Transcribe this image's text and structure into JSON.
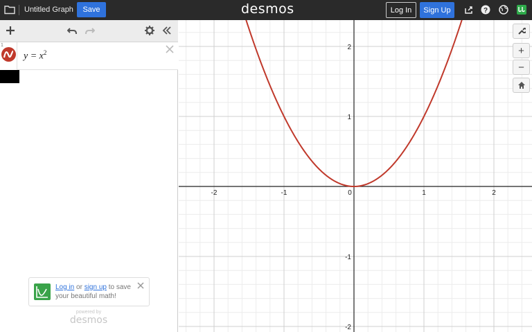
{
  "topbar": {
    "title": "Untitled Graph",
    "save_label": "Save",
    "brand": "desmos",
    "login_label": "Log In",
    "signup_label": "Sign Up",
    "icons": [
      "folder-icon",
      "share-icon",
      "help-icon",
      "language-icon",
      "account-icon"
    ]
  },
  "toolbar": {
    "icons": [
      "add-icon",
      "undo-icon",
      "redo-icon",
      "settings-icon",
      "collapse-icon"
    ]
  },
  "expressions": [
    {
      "number": "1",
      "latex_lhs": "y = x",
      "exponent": "2",
      "color": "#c0392b"
    }
  ],
  "promo": {
    "login_link": "Log in",
    "or_text": " or ",
    "signup_link": "sign up",
    "rest_text": " to save your beautiful math!"
  },
  "powered": {
    "line1": "powered by",
    "line2": "desmos"
  },
  "graph": {
    "x_ticks": [
      "-2",
      "-1",
      "0",
      "1",
      "2"
    ],
    "y_ticks": [
      "2",
      "1",
      "-1",
      "-2"
    ],
    "curve_color": "#c0392b",
    "zoom_in_label": "+",
    "zoom_out_label": "−"
  },
  "chart_data": {
    "type": "line",
    "title": "",
    "xlabel": "",
    "ylabel": "",
    "xlim": [
      -2.5,
      2.5
    ],
    "ylim": [
      -2,
      2
    ],
    "grid": true,
    "series": [
      {
        "name": "",
        "function": "x^2",
        "x": [
          -1.5,
          -1,
          -0.5,
          0,
          0.5,
          1,
          1.5
        ],
        "y": [
          2.25,
          1,
          0.25,
          0,
          0.25,
          1,
          2.25
        ]
      }
    ]
  }
}
